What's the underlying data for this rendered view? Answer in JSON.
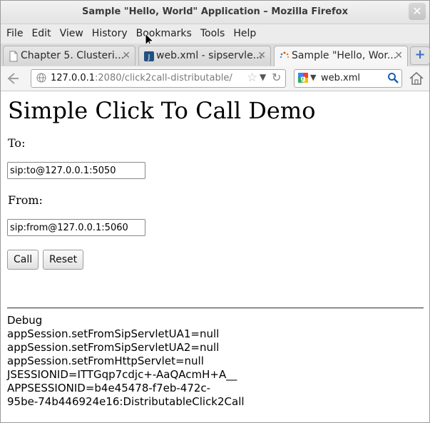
{
  "window": {
    "title": "Sample \"Hello, World\" Application – Mozilla Firefox",
    "close_glyph": "✕"
  },
  "menu": [
    "File",
    "Edit",
    "View",
    "History",
    "Bookmarks",
    "Tools",
    "Help"
  ],
  "tabs": [
    {
      "label": "Chapter 5. Clusteri...",
      "icon": "document-icon",
      "active": false
    },
    {
      "label": "web.xml - sipservle...",
      "icon": "jira-icon",
      "active": false
    },
    {
      "label": "Sample \"Hello, Wor...",
      "icon": "loading-icon",
      "active": true
    }
  ],
  "tab_close_glyph": "✕",
  "new_tab_glyph": "+",
  "navigation": {
    "url_host": "127.0.0.1",
    "url_rest": ":2080/click2call-distributable/",
    "search_value": "web.xml"
  },
  "page": {
    "title": "Simple Click To Call Demo",
    "to_label": "To:",
    "to_value": "sip:to@127.0.0.1:5050",
    "from_label": "From:",
    "from_value": "sip:from@127.0.0.1:5060",
    "call_button": "Call",
    "reset_button": "Reset",
    "debug_lines": [
      "Debug",
      "appSession.setFromSipServletUA1=null",
      "appSession.setFromSipServletUA2=null",
      "appSession.setFromHttpServlet=null",
      "JSESSIONID=ITTGqp7cdjc+-AaQAcmH+A__",
      "APPSESSIONID=b4e45478-f7eb-472c-",
      "95be-74b446924e16:DistributableClick2Call"
    ]
  },
  "colors": {
    "accent": "#3b6fc4",
    "window_bg": "#ececec"
  }
}
